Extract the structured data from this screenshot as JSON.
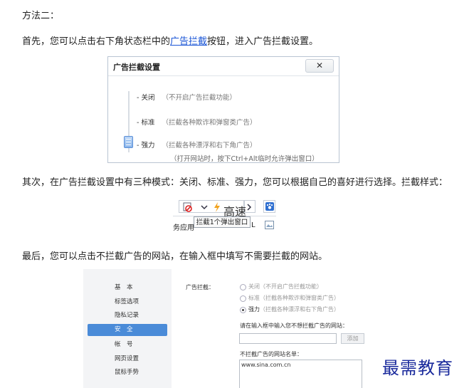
{
  "doc": {
    "heading": "方法二：",
    "p1_before": "首先，您可以点击右下角状态栏中的",
    "p1_link": "广告拦截",
    "p1_after": "按钮，进入广告拦截设置。",
    "p2": "其次，在广告拦截设置中有三种模式：关闭、标准、强力，您可以根据自己的喜好进行选择。拦截样式：",
    "p3": "最后，您可以点击不拦截广告的网站，在输入框中填写不需要拦截的网站。"
  },
  "dialog": {
    "title": "广告拦截设置",
    "close": "✕",
    "levels": [
      {
        "label": "- 关闭",
        "desc": "（不开启广告拦截功能）"
      },
      {
        "label": "- 标准",
        "desc": "（拦截各种欺诈和弹窗类广告）"
      },
      {
        "label": "- 强力",
        "desc": "（拦截各种漂浮和右下角广告）"
      }
    ],
    "extra": "（打开网站时，按下Ctrl+Alt临时允许弹出窗口）",
    "selected_level": "强力"
  },
  "toolbar": {
    "speed_label": "高速",
    "tooltip": "拦截1个弹出窗口",
    "below_left": "务应用",
    "below_mid": "L",
    "icons": [
      "ad-block-icon",
      "chevron-down-icon",
      "lightning-icon",
      "chevron-right-icon",
      "paw-icon",
      "picture-icon"
    ]
  },
  "settings": {
    "nav": [
      "基　本",
      "标签选项",
      "隐私记录",
      "安　全",
      "帐　号",
      "网页设置",
      "鼠标手势"
    ],
    "active": "安　全",
    "section_label": "广告拦截：",
    "options": [
      {
        "label": "关闭",
        "desc": "（不开启广告拦截功能）"
      },
      {
        "label": "标准",
        "desc": "（拦截各种欺诈和弹窗类广告）"
      },
      {
        "label": "强力",
        "desc": "（拦截各种漂浮和右下角广告）"
      }
    ],
    "input_prompt": "请在输入框中输入您不想拦截广告的网站：",
    "add_button": "添加",
    "list_title": "不拦截广告的网站名单：",
    "list_items": [
      "www.sina.com.cn"
    ]
  },
  "watermark": "最需教育"
}
